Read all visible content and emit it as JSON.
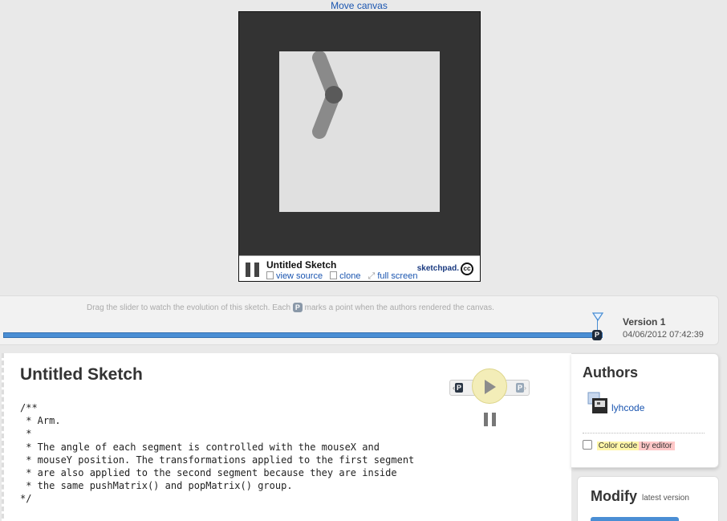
{
  "canvas": {
    "move_label": "Move canvas",
    "sketch_title": "Untitled Sketch",
    "links": {
      "view_source": "view source",
      "clone": "clone",
      "full_screen": "full screen"
    },
    "brand": "sketchpad.",
    "license_icon": "cc"
  },
  "timeline": {
    "hint_before": "Drag the slider to watch the evolution of this sketch. Each",
    "hint_badge": "P",
    "hint_after": "marks a point when the authors rendered the canvas.",
    "marker": "P",
    "version_title": "Version 1",
    "version_date": "04/06/2012 07:42:39",
    "progress": 1.0
  },
  "main": {
    "title": "Untitled Sketch",
    "code_lines": [
      "/**",
      " * Arm.",
      " *",
      " * The angle of each segment is controlled with the mouseX and",
      " * mouseY position. The transformations applied to the first segment",
      " * are also applied to the second segment because they are inside",
      " * the same pushMatrix() and popMatrix() group.",
      "*/"
    ],
    "playback": {
      "prev_badge": "P",
      "next_badge": "P"
    }
  },
  "authors": {
    "title": "Authors",
    "list": [
      {
        "name": "lyhcode"
      }
    ],
    "color_label": "Color code",
    "color_by": "by editor"
  },
  "modify": {
    "title": "Modify",
    "subtitle": "latest version"
  },
  "colors": {
    "accent": "#4a8ed4",
    "link": "#1a55b0",
    "canvas_bg": "#333333",
    "sketch_bg": "#e0e0e0"
  }
}
